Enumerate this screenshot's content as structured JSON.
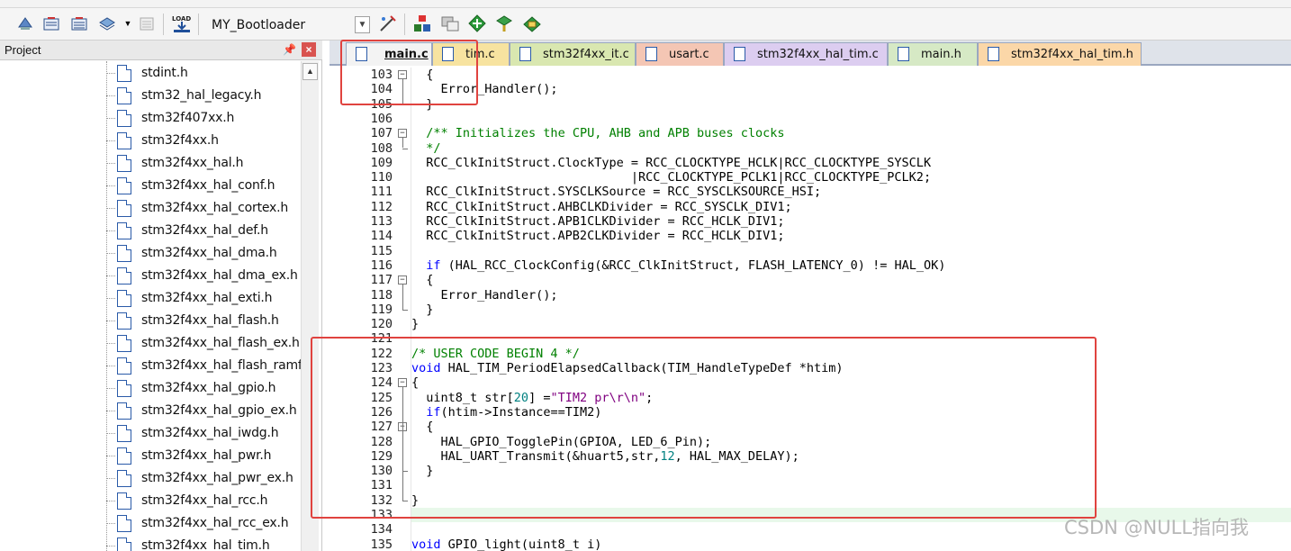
{
  "toolbar": {
    "target_name": "MY_Bootloader",
    "icons": [
      "translate-icon",
      "build-icon",
      "rebuild-icon",
      "batch-build-icon",
      "stop-build-icon",
      "download-icon",
      "target-options-icon",
      "manage-project-icon",
      "select-packs-icon",
      "pack-installer-icon",
      "run-time-env-icon",
      "manage-components-icon"
    ]
  },
  "project": {
    "title": "Project",
    "files": [
      "stdint.h",
      "stm32_hal_legacy.h",
      "stm32f407xx.h",
      "stm32f4xx.h",
      "stm32f4xx_hal.h",
      "stm32f4xx_hal_conf.h",
      "stm32f4xx_hal_cortex.h",
      "stm32f4xx_hal_def.h",
      "stm32f4xx_hal_dma.h",
      "stm32f4xx_hal_dma_ex.h",
      "stm32f4xx_hal_exti.h",
      "stm32f4xx_hal_flash.h",
      "stm32f4xx_hal_flash_ex.h",
      "stm32f4xx_hal_flash_ramfu",
      "stm32f4xx_hal_gpio.h",
      "stm32f4xx_hal_gpio_ex.h",
      "stm32f4xx_hal_iwdg.h",
      "stm32f4xx_hal_pwr.h",
      "stm32f4xx_hal_pwr_ex.h",
      "stm32f4xx_hal_rcc.h",
      "stm32f4xx_hal_rcc_ex.h",
      "stm32f4xx_hal_tim.h"
    ]
  },
  "tabs": [
    {
      "label": "main.c",
      "color": "#f3f3f3",
      "active": true
    },
    {
      "label": "tim.c",
      "color": "#f7e3a0"
    },
    {
      "label": "stm32f4xx_it.c",
      "color": "#d9e7b0"
    },
    {
      "label": "usart.c",
      "color": "#f4c6b4"
    },
    {
      "label": "stm32f4xx_hal_tim.c",
      "color": "#dccdf0"
    },
    {
      "label": "main.h",
      "color": "#d6e9c5"
    },
    {
      "label": "stm32f4xx_hal_tim.h",
      "color": "#fbd7a8"
    }
  ],
  "code_lines": [
    {
      "n": "103",
      "text": "  {"
    },
    {
      "n": "104",
      "text": "    Error_Handler();"
    },
    {
      "n": "105",
      "text": "  }"
    },
    {
      "n": "106",
      "text": ""
    },
    {
      "n": "107",
      "text": "  /** Initializes the CPU, AHB and APB buses clocks"
    },
    {
      "n": "108",
      "text": "  */"
    },
    {
      "n": "109",
      "text": "  RCC_ClkInitStruct.ClockType = RCC_CLOCKTYPE_HCLK|RCC_CLOCKTYPE_SYSCLK"
    },
    {
      "n": "110",
      "text": "                              |RCC_CLOCKTYPE_PCLK1|RCC_CLOCKTYPE_PCLK2;"
    },
    {
      "n": "111",
      "text": "  RCC_ClkInitStruct.SYSCLKSource = RCC_SYSCLKSOURCE_HSI;"
    },
    {
      "n": "112",
      "text": "  RCC_ClkInitStruct.AHBCLKDivider = RCC_SYSCLK_DIV1;"
    },
    {
      "n": "113",
      "text": "  RCC_ClkInitStruct.APB1CLKDivider = RCC_HCLK_DIV1;"
    },
    {
      "n": "114",
      "text": "  RCC_ClkInitStruct.APB2CLKDivider = RCC_HCLK_DIV1;"
    },
    {
      "n": "115",
      "text": ""
    },
    {
      "n": "116",
      "text": "  if (HAL_RCC_ClockConfig(&RCC_ClkInitStruct, FLASH_LATENCY_0) != HAL_OK)"
    },
    {
      "n": "117",
      "text": "  {"
    },
    {
      "n": "118",
      "text": "    Error_Handler();"
    },
    {
      "n": "119",
      "text": "  }"
    },
    {
      "n": "120",
      "text": "}"
    },
    {
      "n": "121",
      "text": ""
    },
    {
      "n": "122",
      "text": "/* USER CODE BEGIN 4 */"
    },
    {
      "n": "123",
      "text": "void HAL_TIM_PeriodElapsedCallback(TIM_HandleTypeDef *htim)"
    },
    {
      "n": "124",
      "text": "{"
    },
    {
      "n": "125",
      "text": "  uint8_t str[20] =\"TIM2 pr\\r\\n\";"
    },
    {
      "n": "126",
      "text": "  if(htim->Instance==TIM2)"
    },
    {
      "n": "127",
      "text": "  {"
    },
    {
      "n": "128",
      "text": "    HAL_GPIO_TogglePin(GPIOA, LED_6_Pin);"
    },
    {
      "n": "129",
      "text": "    HAL_UART_Transmit(&huart5,str,12, HAL_MAX_DELAY);"
    },
    {
      "n": "130",
      "text": "  }"
    },
    {
      "n": "131",
      "text": ""
    },
    {
      "n": "132",
      "text": "}"
    },
    {
      "n": "133",
      "text": ""
    },
    {
      "n": "134",
      "text": ""
    },
    {
      "n": "135",
      "text": "void GPIO_light(uint8_t i)"
    }
  ],
  "watermark": "CSDN @NULL指向我"
}
